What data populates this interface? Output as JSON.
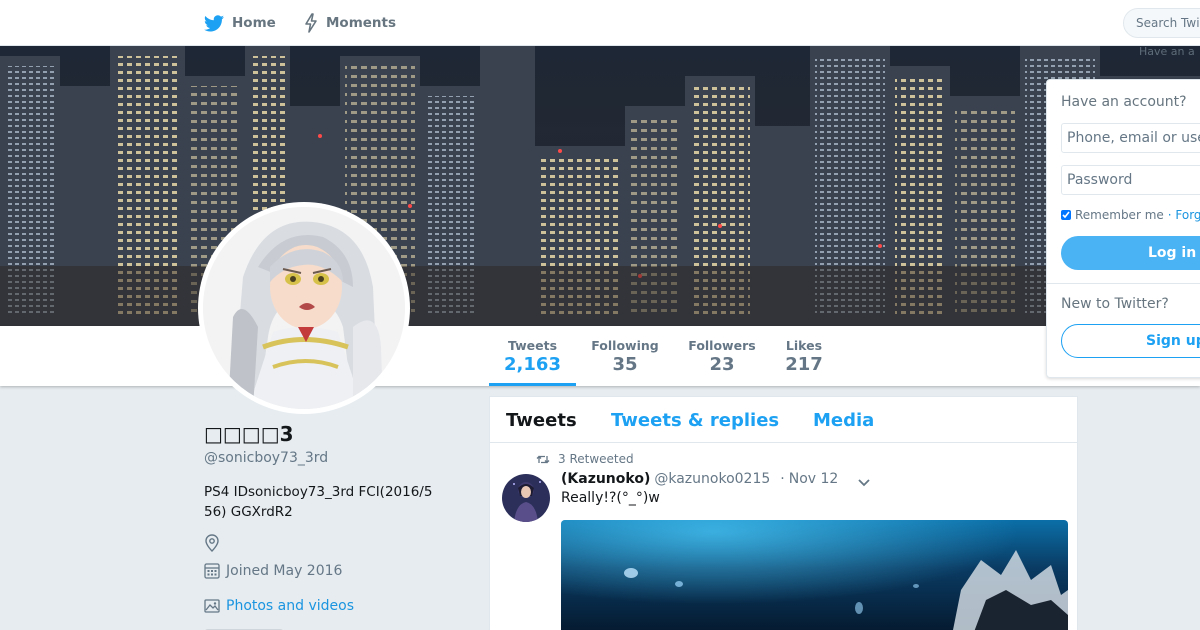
{
  "nav": {
    "home_label": "Home",
    "moments_label": "Moments",
    "search_placeholder": "Search Twi"
  },
  "profile": {
    "name": "□□□□3",
    "handle": "@sonicboy73_3rd",
    "bio": "PS4 IDsonicboy73_3rd FCI(2016/5 56) GGXrdR2",
    "joined": "Joined May 2016",
    "photos_link": "Photos and videos"
  },
  "stats": [
    {
      "label": "Tweets",
      "value": "2,163"
    },
    {
      "label": "Following",
      "value": "35"
    },
    {
      "label": "Followers",
      "value": "23"
    },
    {
      "label": "Likes",
      "value": "217"
    }
  ],
  "timeline": {
    "tabs": [
      "Tweets",
      "Tweets & replies",
      "Media"
    ],
    "tweet": {
      "retweet_context": "3 Retweeted",
      "fullname": "(Kazunoko)",
      "username": "@kazunoko0215",
      "dot": "·",
      "time": "Nov 12",
      "text": "Really!?(°_°)w"
    }
  },
  "login": {
    "overlay_text": "Have an a",
    "title": "Have an account?",
    "phone_placeholder": "Phone, email or use",
    "password_placeholder": "Password",
    "remember": "Remember me",
    "forgot": "· Forg",
    "login_button": "Log in",
    "new_to": "New to Twitter?",
    "signup_button": "Sign up"
  },
  "colors": {
    "accent": "#1da1f2",
    "link": "#1b95e0",
    "background": "#e6ecf0"
  }
}
